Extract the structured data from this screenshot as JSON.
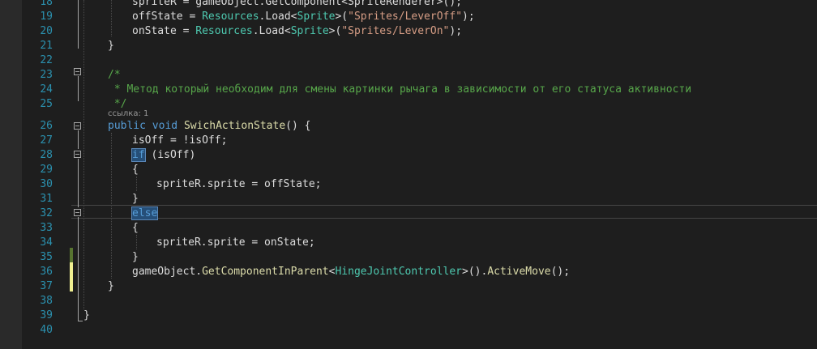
{
  "editor": {
    "codelens": "ссылка: 1",
    "lines": [
      {
        "n": "18",
        "indent": 2,
        "tokens": [
          {
            "t": "spriteR = gameObject.GetComponent<SpriteRenderer>();",
            "c": ""
          }
        ]
      },
      {
        "n": "19",
        "indent": 2,
        "tokens": [
          {
            "t": "offState = ",
            "c": ""
          },
          {
            "t": "Resources",
            "c": "ty"
          },
          {
            "t": ".Load<",
            "c": ""
          },
          {
            "t": "Sprite",
            "c": "ty"
          },
          {
            "t": ">(",
            "c": ""
          },
          {
            "t": "\"Sprites/LeverOff\"",
            "c": "st"
          },
          {
            "t": ");",
            "c": ""
          }
        ]
      },
      {
        "n": "20",
        "indent": 2,
        "tokens": [
          {
            "t": "onState = ",
            "c": ""
          },
          {
            "t": "Resources",
            "c": "ty"
          },
          {
            "t": ".Load<",
            "c": ""
          },
          {
            "t": "Sprite",
            "c": "ty"
          },
          {
            "t": ">(",
            "c": ""
          },
          {
            "t": "\"Sprites/LeverOn\"",
            "c": "st"
          },
          {
            "t": ");",
            "c": ""
          }
        ]
      },
      {
        "n": "21",
        "indent": 1,
        "tokens": [
          {
            "t": "}",
            "c": ""
          }
        ]
      },
      {
        "n": "22",
        "indent": 0,
        "tokens": []
      },
      {
        "n": "23",
        "indent": 1,
        "tokens": [
          {
            "t": "/*",
            "c": "cm"
          }
        ]
      },
      {
        "n": "24",
        "indent": 1,
        "tokens": [
          {
            "t": " * Метод который необходим для смены картинки рычага в зависимости от его статуса активности",
            "c": "cm"
          }
        ]
      },
      {
        "n": "25",
        "indent": 1,
        "tokens": [
          {
            "t": " */",
            "c": "cm"
          }
        ]
      },
      {
        "n": "26",
        "indent": 1,
        "tokens": [
          {
            "t": "public",
            "c": "kw"
          },
          {
            "t": " ",
            "c": ""
          },
          {
            "t": "void",
            "c": "kw"
          },
          {
            "t": " ",
            "c": ""
          },
          {
            "t": "SwichActionState",
            "c": "mt"
          },
          {
            "t": "() {",
            "c": ""
          }
        ]
      },
      {
        "n": "27",
        "indent": 2,
        "tokens": [
          {
            "t": "isOff = !isOff;",
            "c": ""
          }
        ]
      },
      {
        "n": "28",
        "indent": 2,
        "tokens": [
          {
            "t": "if",
            "c": "kw hl"
          },
          {
            "t": " (isOff)",
            "c": ""
          }
        ]
      },
      {
        "n": "29",
        "indent": 2,
        "tokens": [
          {
            "t": "{",
            "c": ""
          }
        ]
      },
      {
        "n": "30",
        "indent": 3,
        "tokens": [
          {
            "t": "spriteR.sprite = offState;",
            "c": ""
          }
        ]
      },
      {
        "n": "31",
        "indent": 2,
        "tokens": [
          {
            "t": "}",
            "c": ""
          }
        ]
      },
      {
        "n": "32",
        "indent": 2,
        "tokens": [
          {
            "t": "else",
            "c": "kw hl"
          }
        ]
      },
      {
        "n": "33",
        "indent": 2,
        "tokens": [
          {
            "t": "{",
            "c": ""
          }
        ]
      },
      {
        "n": "34",
        "indent": 3,
        "tokens": [
          {
            "t": "spriteR.sprite = onState;",
            "c": ""
          }
        ]
      },
      {
        "n": "35",
        "indent": 2,
        "tokens": [
          {
            "t": "}",
            "c": ""
          }
        ]
      },
      {
        "n": "36",
        "indent": 2,
        "tokens": [
          {
            "t": "gameObject.",
            "c": ""
          },
          {
            "t": "GetComponentInParent",
            "c": "mt"
          },
          {
            "t": "<",
            "c": ""
          },
          {
            "t": "HingeJointController",
            "c": "ty"
          },
          {
            "t": ">().",
            "c": ""
          },
          {
            "t": "ActiveMove",
            "c": "mt"
          },
          {
            "t": "();",
            "c": ""
          }
        ]
      },
      {
        "n": "37",
        "indent": 1,
        "tokens": [
          {
            "t": "}",
            "c": ""
          }
        ]
      },
      {
        "n": "38",
        "indent": 0,
        "tokens": []
      },
      {
        "n": "39",
        "indent": 0,
        "tokens": [
          {
            "t": "}",
            "c": ""
          }
        ]
      },
      {
        "n": "40",
        "indent": 0,
        "tokens": []
      }
    ]
  },
  "colors": {
    "background": "#1e1e1e",
    "line_number": "#2b91af",
    "keyword": "#569cd6",
    "type": "#4ec9b0",
    "string": "#d69d85",
    "comment": "#57a64a",
    "method": "#dcdcaa",
    "change_saved": "#577430",
    "change_unsaved": "#efef91"
  }
}
